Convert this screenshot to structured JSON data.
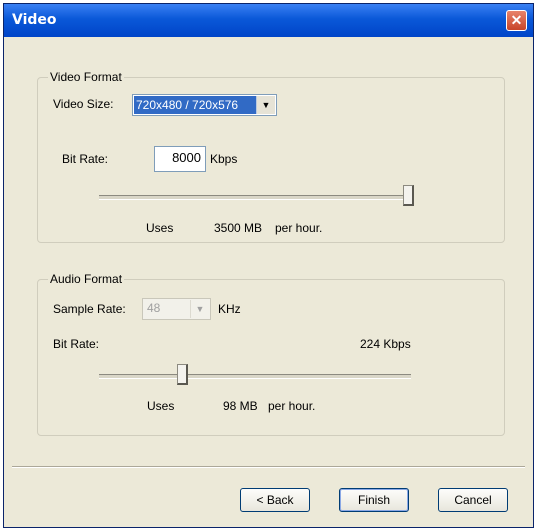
{
  "window": {
    "title": "Video",
    "close_glyph": "✕"
  },
  "video_format": {
    "group_title": "Video Format",
    "video_size_label": "Video Size:",
    "video_size_value": "720x480 / 720x576",
    "bit_rate_label": "Bit Rate:",
    "bit_rate_value": "8000",
    "bit_rate_unit": "Kbps",
    "slider_fraction": 1.0,
    "uses_label": "Uses",
    "uses_value": "3500 MB",
    "per_hour": "per hour."
  },
  "audio_format": {
    "group_title": "Audio Format",
    "sample_rate_label": "Sample Rate:",
    "sample_rate_value": "48",
    "sample_rate_unit": "KHz",
    "bit_rate_label": "Bit Rate:",
    "bit_rate_display": "224 Kbps",
    "slider_fraction": 0.26,
    "uses_label": "Uses",
    "uses_value": "98 MB",
    "per_hour": "per hour."
  },
  "buttons": {
    "back": "< Back",
    "finish": "Finish",
    "cancel": "Cancel"
  },
  "icons": {
    "dropdown": "chevron-down-icon",
    "close": "close-icon"
  }
}
